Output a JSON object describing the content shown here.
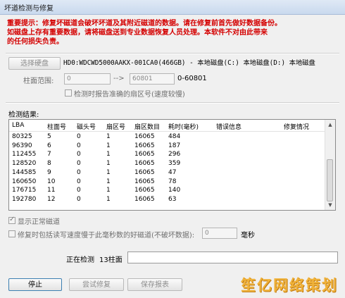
{
  "window": {
    "title": "坏道检测与修复"
  },
  "warning": {
    "line1": "重要提示：修复坏磁道会破坏坏道及其附近磁道的数据。请在修复前首先做好数据备份。",
    "line2": "如磁盘上存有重要数据，请将磁盘送到专业数据恢复人员处理。本软件不对由此带来",
    "line3": "的任何损失负责。"
  },
  "disk": {
    "select_button": "选择硬盘",
    "info": "HD0:WDCWD5000AAKX-001CA0(466GB) - 本地磁盘(C:) 本地磁盘(D:) 本地磁盘"
  },
  "range": {
    "label": "柱面范围:",
    "from": "0",
    "arrow": "-->",
    "to": "60801",
    "span": "0-60801"
  },
  "options": {
    "report_exact_sector": "检测时报告准确的扇区号(速度较慢)",
    "show_normal": "显示正常磁道",
    "repair_option": "修复时包括读写速度慢于此毫秒数的好磁道(不破坏数据):",
    "ms_value": "0",
    "ms_unit": "毫秒"
  },
  "results": {
    "label": "检测结果:",
    "columns": [
      "LBA",
      "柱面号",
      "磁头号",
      "扇区号",
      "扇区数目",
      "耗时(毫秒)",
      "错误信息",
      "修复情况"
    ],
    "rows": [
      [
        "80325",
        "5",
        "0",
        "1",
        "16065",
        "484",
        "",
        ""
      ],
      [
        "96390",
        "6",
        "0",
        "1",
        "16065",
        "187",
        "",
        ""
      ],
      [
        "112455",
        "7",
        "0",
        "1",
        "16065",
        "296",
        "",
        ""
      ],
      [
        "128520",
        "8",
        "0",
        "1",
        "16065",
        "359",
        "",
        ""
      ],
      [
        "144585",
        "9",
        "0",
        "1",
        "16065",
        "47",
        "",
        ""
      ],
      [
        "160650",
        "10",
        "0",
        "1",
        "16065",
        "78",
        "",
        ""
      ],
      [
        "176715",
        "11",
        "0",
        "1",
        "16065",
        "140",
        "",
        ""
      ],
      [
        "192780",
        "12",
        "0",
        "1",
        "16065",
        "63",
        "",
        ""
      ]
    ]
  },
  "status": {
    "label": "正在检测",
    "value": "13柱面"
  },
  "buttons": {
    "stop": "停止",
    "try_repair": "尝试修复",
    "save_report": "保存报表"
  },
  "watermark": "笙亿网络策划"
}
